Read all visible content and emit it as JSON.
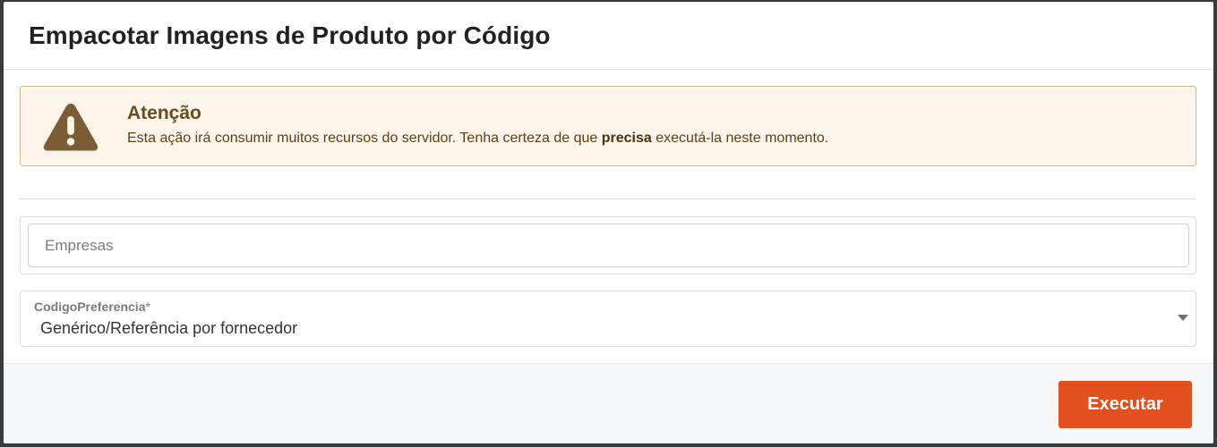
{
  "modal": {
    "title": "Empacotar Imagens de Produto por Código"
  },
  "alert": {
    "icon": "warning-triangle-icon",
    "title": "Atenção",
    "text_before": "Esta ação irá consumir muitos recursos do servidor. Tenha certeza de que ",
    "text_bold": "precisa",
    "text_after": " executá-la neste momento.",
    "colors": {
      "background": "#fdf5ea",
      "border": "#c9b98e",
      "icon": "#7a5c35"
    }
  },
  "form": {
    "empresas_placeholder": "Empresas",
    "empresas_value": "",
    "codigo_preferencia": {
      "label": "CodigoPreferencia",
      "required_mark": "*",
      "selected": "Genérico/Referência por fornecedor",
      "caret_icon": "caret-down-icon"
    }
  },
  "footer": {
    "execute_label": "Executar",
    "execute_color": "#e2501f"
  }
}
